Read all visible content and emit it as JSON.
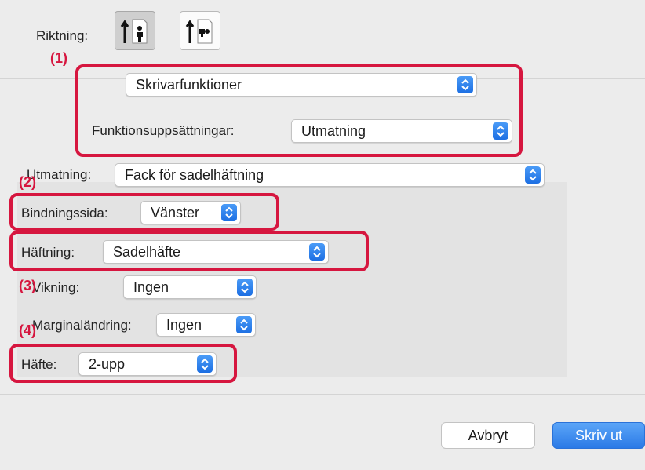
{
  "orientation": {
    "label": "Riktning:",
    "options": [
      {
        "name": "portrait",
        "icon": "portrait-person-icon",
        "selected": true
      },
      {
        "name": "landscape",
        "icon": "landscape-person-icon",
        "selected": false
      }
    ]
  },
  "section_menu": {
    "value": "Skrivarfunktioner"
  },
  "feature_sets": {
    "label": "Funktionsuppsättningar:",
    "value": "Utmatning"
  },
  "output": {
    "label": "Utmatning:",
    "value": "Fack för sadelhäftning"
  },
  "binding_edge": {
    "label": "Bindningssida:",
    "value": "Vänster"
  },
  "stapling": {
    "label": "Häftning:",
    "value": "Sadelhäfte"
  },
  "folding": {
    "label": "Vikning:",
    "value": "Ingen"
  },
  "margin_shift": {
    "label": "Marginaländring:",
    "value": "Ingen"
  },
  "booklet": {
    "label": "Häfte:",
    "value": "2-upp"
  },
  "callouts": [
    "(1)",
    "(2)",
    "(3)",
    "(4)"
  ],
  "buttons": {
    "cancel": "Avbryt",
    "print": "Skriv ut"
  },
  "colors": {
    "callout": "#d6163f",
    "accent": "#1d6fe3"
  }
}
